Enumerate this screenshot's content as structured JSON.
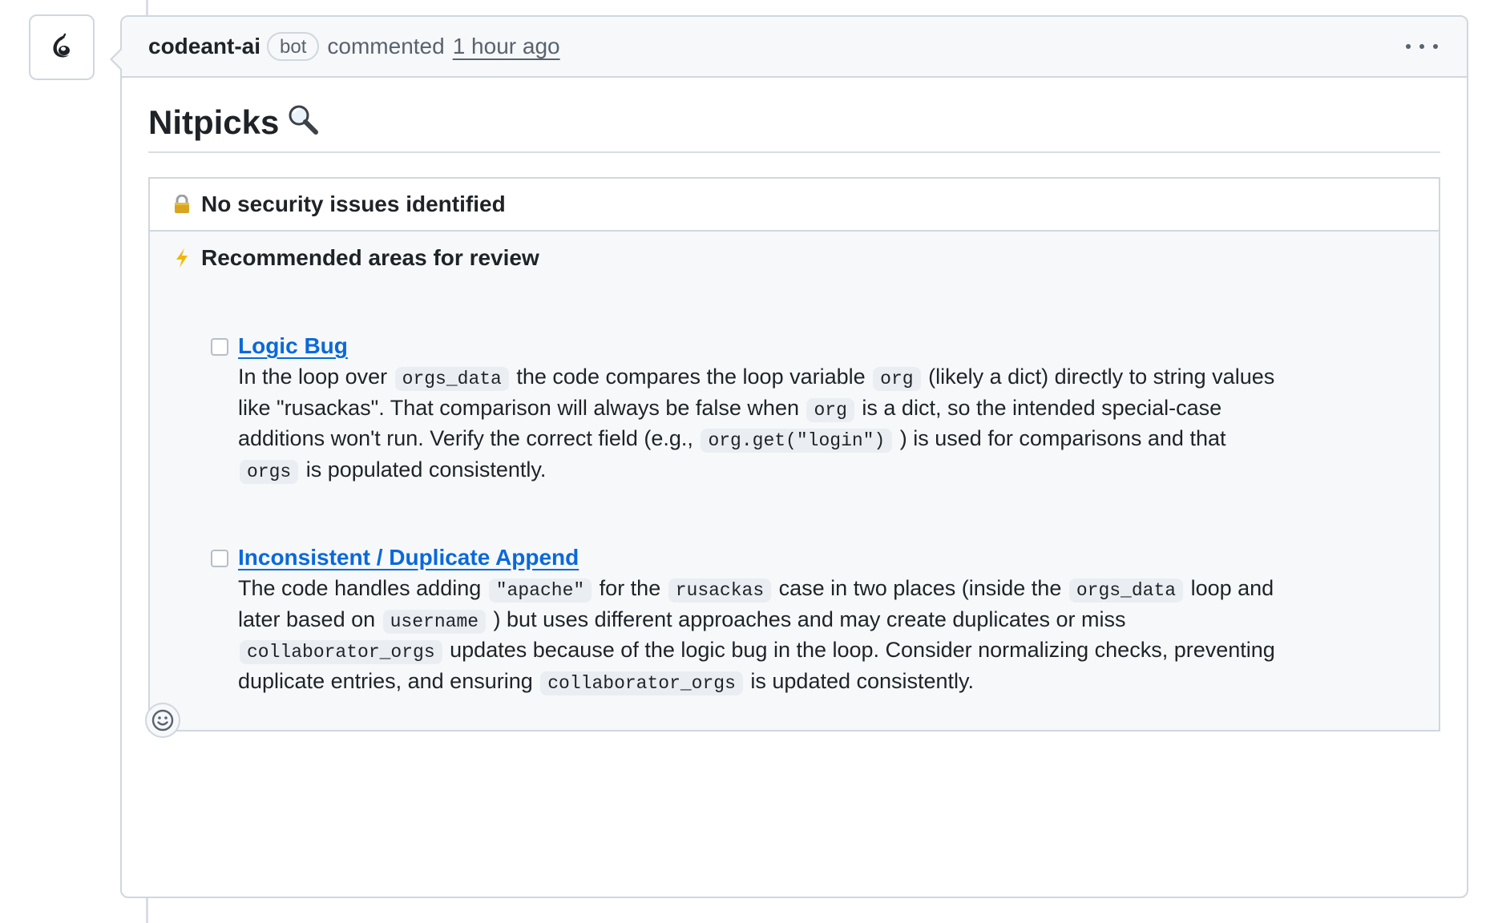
{
  "comment": {
    "author": "codeant-ai",
    "badge": "bot",
    "action": "commented",
    "timestamp": "1 hour ago",
    "more_icon": "kebab-horizontal-icon"
  },
  "title": {
    "text": "Nitpicks",
    "icon": "magnifying-glass-icon"
  },
  "security": {
    "icon": "lock-icon",
    "text": "No security issues identified"
  },
  "review": {
    "icon": "lightning-icon",
    "heading": "Recommended areas for review",
    "items": [
      {
        "title": "Logic Bug",
        "checked": false,
        "t0": "In the loop over ",
        "c0": "orgs_data",
        "t1": " the code compares the loop variable ",
        "c1": "org",
        "t2": " (likely a dict) directly to string values like \"rusackas\". That comparison will always be false when ",
        "c2": "org",
        "t3": " is a dict, so the intended special-case additions won't run. Verify the correct field (e.g., ",
        "c3": "org.get(\"login\")",
        "t4": " ) is used for comparisons and that ",
        "c4": "orgs",
        "t5": " is populated consistently."
      },
      {
        "title": "Inconsistent / Duplicate Append",
        "checked": false,
        "t0": "The code handles adding ",
        "c0": "\"apache\"",
        "t1": " for the ",
        "c1": "rusackas",
        "t2": " case in two places (inside the ",
        "c2": "orgs_data",
        "t3": " loop and later based on ",
        "c3": "username",
        "t4": " ) but uses different approaches and may create duplicates or miss ",
        "c4": "collaborator_orgs",
        "t5": " updates because of the logic bug in the loop. Consider normalizing checks, preventing duplicate entries, and ensuring ",
        "c5": "collaborator_orgs",
        "t6": " is updated consistently."
      }
    ]
  },
  "reaction": {
    "icon": "smiley-icon"
  },
  "avatar": {
    "icon": "codeant-logo-icon"
  }
}
